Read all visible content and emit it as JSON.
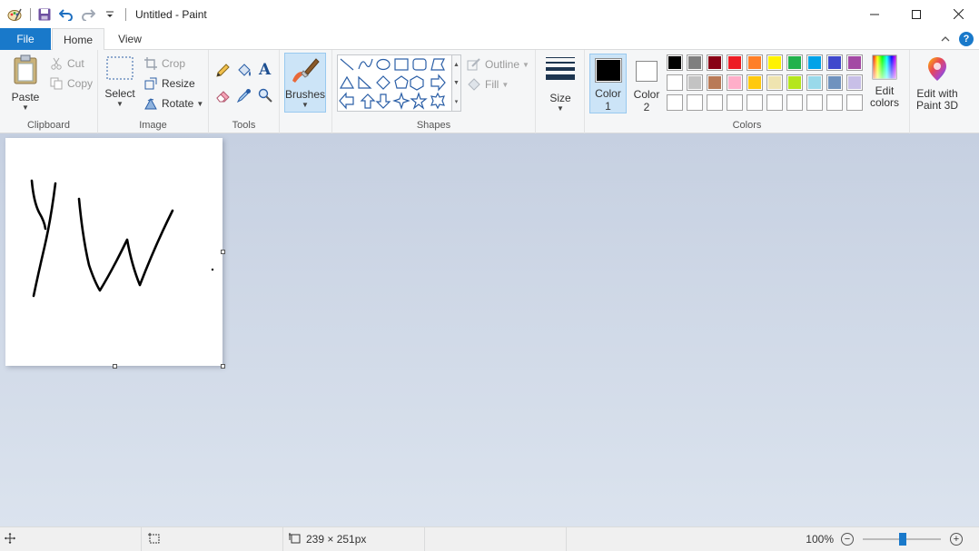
{
  "window": {
    "title": "Untitled - Paint"
  },
  "tabs": {
    "file": "File",
    "home": "Home",
    "view": "View"
  },
  "clipboard": {
    "paste": "Paste",
    "cut": "Cut",
    "copy": "Copy",
    "label": "Clipboard"
  },
  "image": {
    "select": "Select",
    "crop": "Crop",
    "resize": "Resize",
    "rotate": "Rotate",
    "label": "Image"
  },
  "tools": {
    "label": "Tools",
    "text_tool": "A"
  },
  "brushes": {
    "label": "Brushes"
  },
  "shapes": {
    "outline": "Outline",
    "fill": "Fill",
    "label": "Shapes"
  },
  "size": {
    "label": "Size"
  },
  "colors": {
    "color1_label": "Color",
    "color1_num": "1",
    "color2_label": "Color",
    "color2_num": "2",
    "color1": "#000000",
    "color2": "#ffffff",
    "row1": [
      "#000000",
      "#7f7f7f",
      "#880015",
      "#ed1c24",
      "#ff7f27",
      "#fff200",
      "#22b14c",
      "#00a2e8",
      "#3f48cc",
      "#a349a4"
    ],
    "row2": [
      "#ffffff",
      "#c3c3c3",
      "#b97a57",
      "#ffaec9",
      "#ffc90e",
      "#efe4b0",
      "#b5e61d",
      "#99d9ea",
      "#7092be",
      "#c8bfe7"
    ],
    "edit_line1": "Edit",
    "edit_line2": "colors",
    "label": "Colors"
  },
  "paint3d": {
    "line1": "Edit with",
    "line2": "Paint 3D"
  },
  "status": {
    "dimensions": "239 × 251px",
    "zoom": "100%"
  },
  "accent": "#1979ca"
}
